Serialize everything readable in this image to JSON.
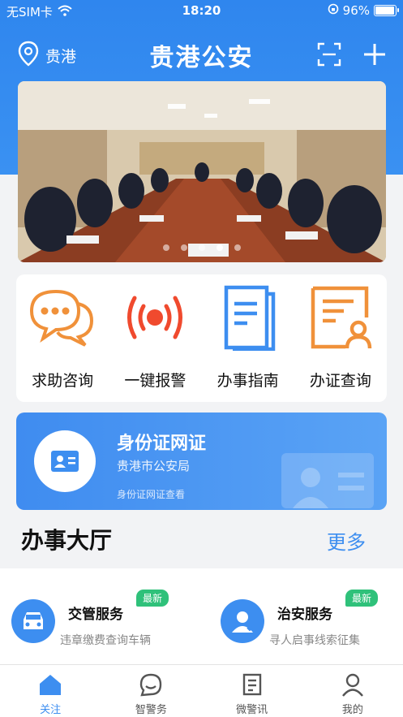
{
  "status": {
    "carrier": "无SIM卡",
    "time": "18:20",
    "battery": "96%",
    "battery_level": 0.96
  },
  "header": {
    "location": "贵港",
    "title": "贵港公安",
    "actions": [
      "scan-icon",
      "plus-icon"
    ]
  },
  "banner": {
    "slides": 5,
    "active_slide": 4
  },
  "quick_actions": [
    {
      "label": "求助咨询",
      "icon": "chat-bubbles-icon",
      "color": "#f0913a"
    },
    {
      "label": "一键报警",
      "icon": "alarm-signal-icon",
      "color": "#f04a2e"
    },
    {
      "label": "办事指南",
      "icon": "document-guide-icon",
      "color": "#3d8ef0"
    },
    {
      "label": "办证查询",
      "icon": "certificate-user-icon",
      "color": "#f0913a"
    }
  ],
  "id_card": {
    "title": "身份证网证",
    "subtitle": "贵港市公安局",
    "link": "身份证网证查看"
  },
  "hall": {
    "title": "办事大厅",
    "more": "更多"
  },
  "services": [
    {
      "title": "交管服务",
      "desc": "违章缴费查询车辆",
      "badge": "最新",
      "icon": "car-icon"
    },
    {
      "title": "治安服务",
      "desc": "寻人启事线索征集",
      "badge": "最新",
      "icon": "person-icon"
    }
  ],
  "tabs": [
    {
      "label": "关注",
      "icon": "home-icon",
      "active": true
    },
    {
      "label": "智警务",
      "icon": "chat-face-icon",
      "active": false
    },
    {
      "label": "微警讯",
      "icon": "news-icon",
      "active": false
    },
    {
      "label": "我的",
      "icon": "user-icon",
      "active": false
    }
  ],
  "colors": {
    "primary": "#3d8ef0",
    "badge": "#2fc17a",
    "orange": "#f0913a",
    "red": "#f04a2e"
  }
}
